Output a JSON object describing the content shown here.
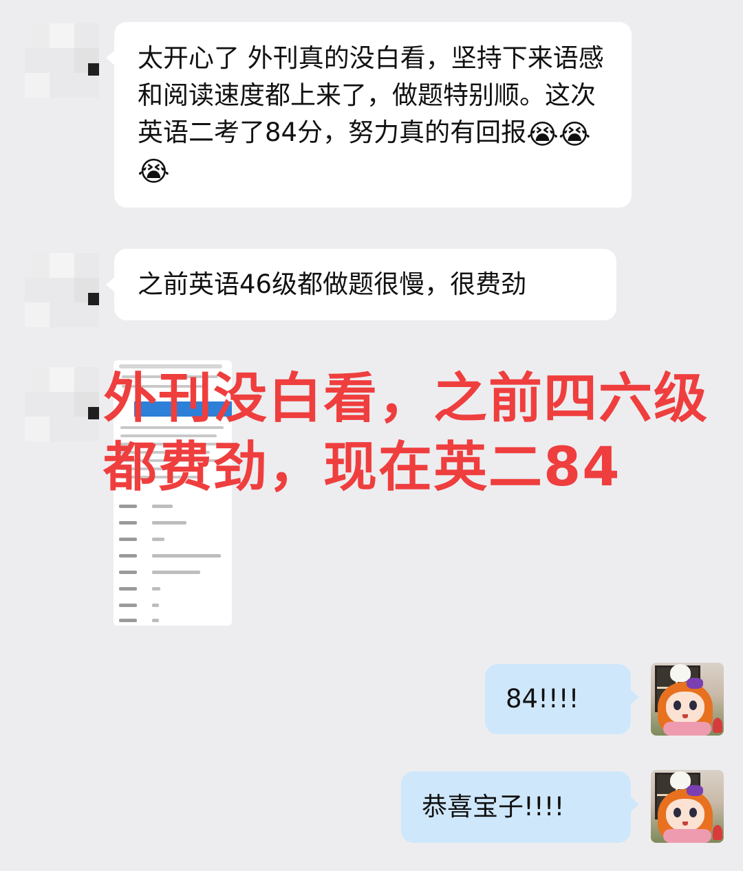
{
  "messages": [
    {
      "text": "太开心了 外刊真的没白看，坚持下来语感和阅读速度都上来了，做题特别顺。这次英语二考了84分，努力真的有回报",
      "emoji": [
        "😭",
        "😭",
        "😭"
      ]
    },
    {
      "text": "之前英语46级都做题很慢，很费劲"
    },
    {
      "text": "84!!!!"
    },
    {
      "text": "恭喜宝子!!!!"
    }
  ],
  "caption": {
    "line1": "外刊没白看，之前四六级",
    "line2": "都费劲，现在英二84"
  },
  "colors": {
    "background": "#ededf0",
    "incoming_bubble": "#ffffff",
    "outgoing_bubble": "#cfe7fb",
    "caption": "#ef3e3e"
  }
}
